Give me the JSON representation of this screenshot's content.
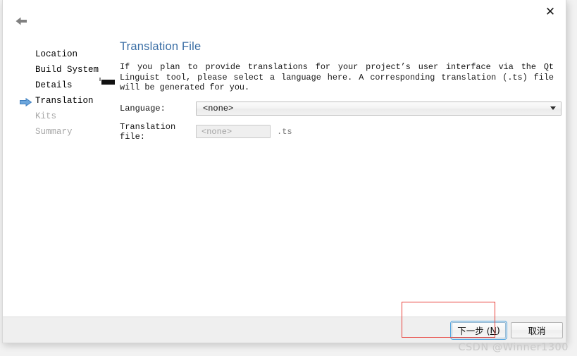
{
  "window": {
    "back_icon": "back-arrow-icon",
    "close_label": "✕"
  },
  "sidebar": {
    "items": [
      {
        "label": "Location",
        "state": "done"
      },
      {
        "label": "Build System",
        "state": "done"
      },
      {
        "label": "Details",
        "state": "done"
      },
      {
        "label": "Translation",
        "state": "current"
      },
      {
        "label": "Kits",
        "state": "upcoming"
      },
      {
        "label": "Summary",
        "state": "upcoming"
      }
    ]
  },
  "main": {
    "title": "Translation File",
    "description": "If you plan to provide translations for your project’s user interface via the Qt Linguist tool, please select a language here. A corresponding translation (.ts) file will be generated for you.",
    "fields": {
      "language": {
        "label": "Language:",
        "value": "<none>"
      },
      "translation_file": {
        "label": "Translation file:",
        "placeholder": "<none>",
        "value": "",
        "suffix": ".ts"
      }
    }
  },
  "footer": {
    "next_button": {
      "text": "下一步 (",
      "mnemonic": "N",
      "text_end": ")"
    },
    "cancel_button": "取消"
  },
  "watermark": {
    "text": "CSDN @Winner1300"
  },
  "colors": {
    "title_blue": "#3a6ea5",
    "annotation_red": "#e8403a",
    "focus_blue": "#4ea3e0",
    "footer_bg": "#efefef"
  }
}
